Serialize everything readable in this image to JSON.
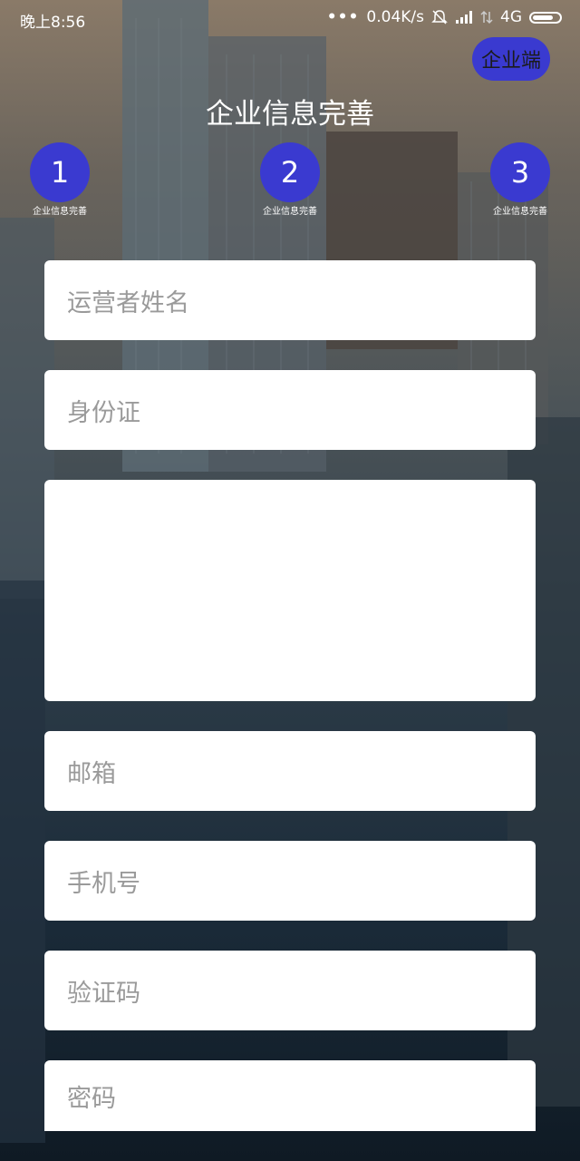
{
  "status_bar": {
    "time": "晚上8:56",
    "more_dots": "•••",
    "network_speed": "0.04K/s",
    "network_type": "4G"
  },
  "header": {
    "corp_button_label": "企业端",
    "title": "企业信息完善"
  },
  "steps": [
    {
      "number": "1",
      "label": "企业信息完善"
    },
    {
      "number": "2",
      "label": "企业信息完善"
    },
    {
      "number": "3",
      "label": "企业信息完善"
    }
  ],
  "form": {
    "operator_name_placeholder": "运营者姓名",
    "id_card_placeholder": "身份证",
    "upload_area_placeholder": "",
    "email_placeholder": "邮箱",
    "phone_placeholder": "手机号",
    "code_placeholder": "验证码",
    "password_placeholder": "密码"
  },
  "colors": {
    "accent": "#3a3ad0",
    "field_bg": "#ffffff",
    "placeholder": "#9a9a9a"
  },
  "icons": [
    "bell-muted-icon",
    "signal-icon",
    "signal-alt-icon",
    "battery-icon"
  ]
}
